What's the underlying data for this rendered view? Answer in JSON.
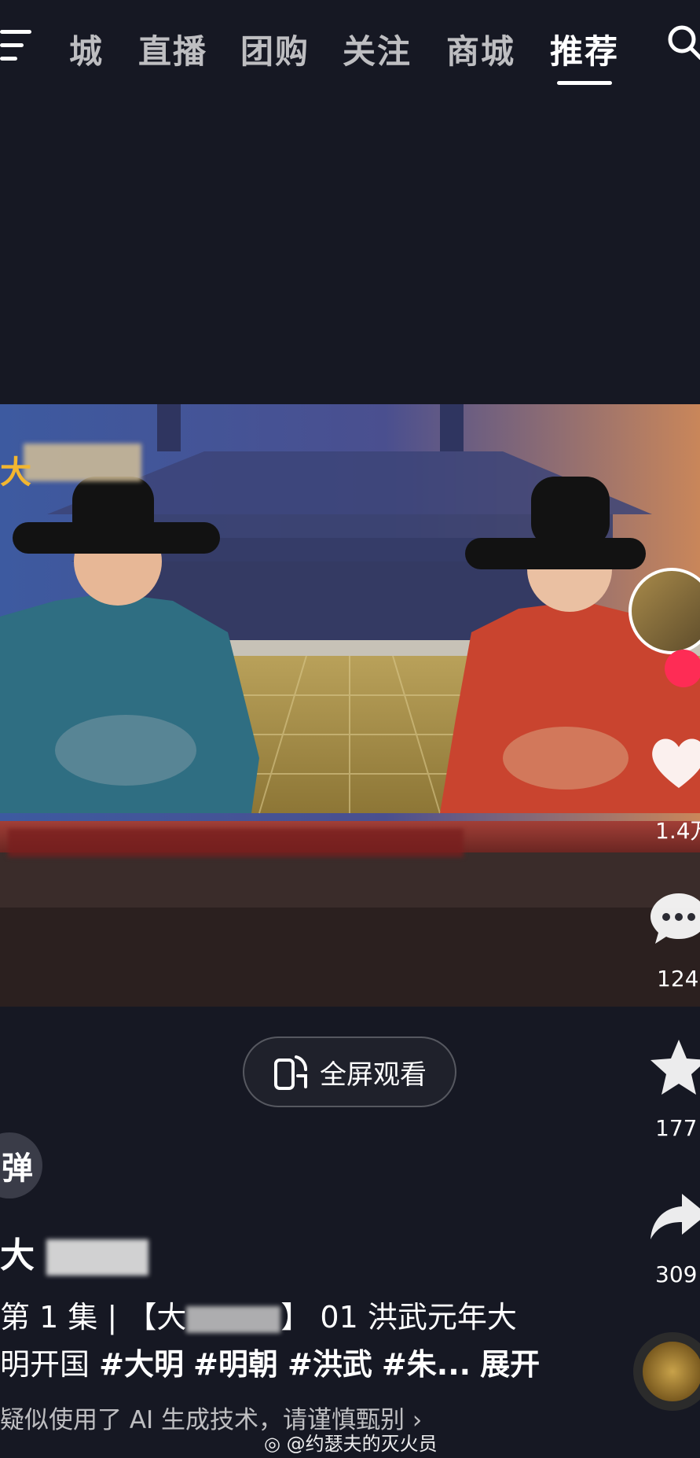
{
  "nav": {
    "tabs": [
      {
        "label": "城"
      },
      {
        "label": "直播"
      },
      {
        "label": "团购"
      },
      {
        "label": "关注"
      },
      {
        "label": "商城"
      },
      {
        "label": "推荐"
      }
    ],
    "active_tab": "推荐",
    "menu_icon": "menu-icon",
    "search_icon": "search-icon"
  },
  "video": {
    "overlay_text": "大",
    "fullscreen_label": "全屏观看"
  },
  "actions": {
    "like_count": "1.4万",
    "comment_count": "124",
    "favorite_count": "177",
    "share_count": "309"
  },
  "info": {
    "author_glyph": "弹",
    "title": "大",
    "desc_line1_a": "第 1 集 |",
    "desc_line1_b": "【大",
    "desc_line1_c": "】 01 洪武元年大",
    "desc_line2_a": "明开国",
    "hashtags": [
      "#大明",
      "#明朝",
      "#洪武",
      "#朱..."
    ],
    "expand_label": "展开",
    "ai_notice": "疑似使用了 AI 生成技术，请谨慎甄别",
    "weibo_watermark": "@约瑟夫的灭火员"
  },
  "colors": {
    "background": "#161823",
    "accent_red": "#fe2c55",
    "overlay_gold": "#f2b630"
  }
}
